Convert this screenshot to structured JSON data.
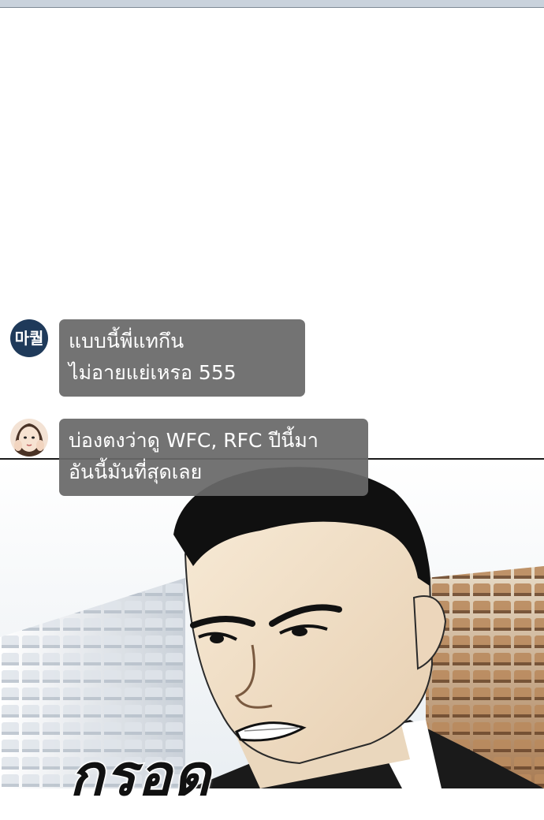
{
  "chat": [
    {
      "avatar": "logo-avatar",
      "avatar_text": "마퀄",
      "lines": [
        "แบบนี้พี่แทกึน",
        "ไม่อายแย่เหรอ 555"
      ]
    },
    {
      "avatar": "woman-face-avatar",
      "lines": [
        "บ่องตงว่าดู WFC, RFC ปีนี้มา",
        "อันนี้มันที่สุดเลย"
      ]
    }
  ],
  "sfx_text": "กรอด",
  "colors": {
    "bubble": "#686868",
    "avatar_logo_bg": "#1f3a5a",
    "top_strip": "#c9d2dc"
  }
}
